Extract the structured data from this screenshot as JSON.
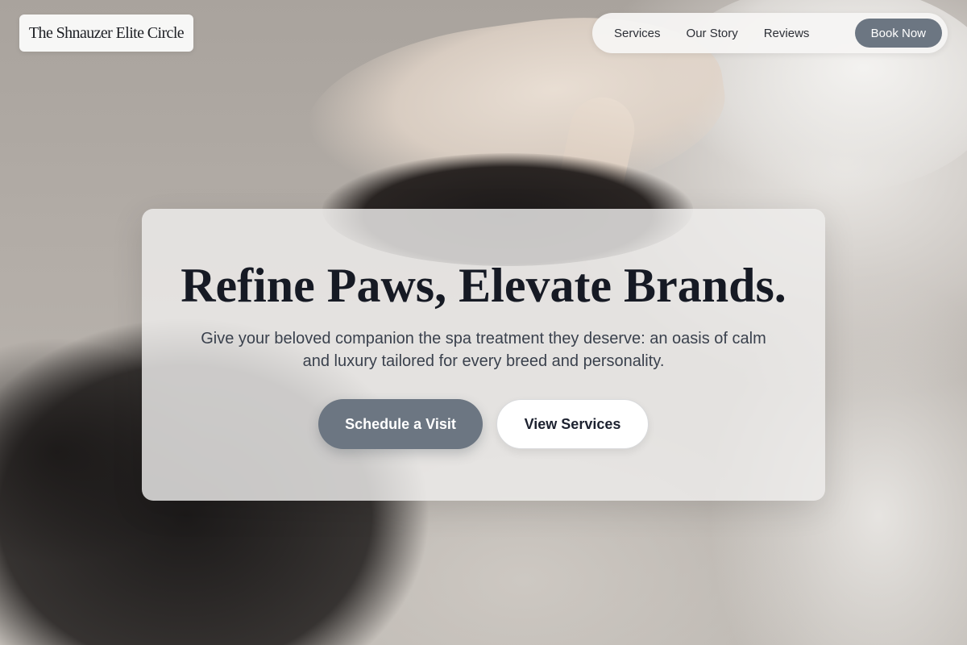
{
  "brand": {
    "name": "The Shnauzer Elite Circle"
  },
  "nav": {
    "links": [
      "Services",
      "Our Story",
      "Reviews"
    ],
    "cta": "Book Now"
  },
  "hero": {
    "headline": "Refine Paws, Elevate Brands.",
    "subtext": "Give your beloved companion the spa treatment they deserve: an oasis of calm and luxury tailored for every breed and personality.",
    "primary_button": "Schedule a Visit",
    "secondary_button": "View Services",
    "background_image": "dog-being-groomed-photo"
  },
  "colors": {
    "accent": "#6c7682",
    "heading": "#161a24",
    "body_text": "#3a414d"
  }
}
